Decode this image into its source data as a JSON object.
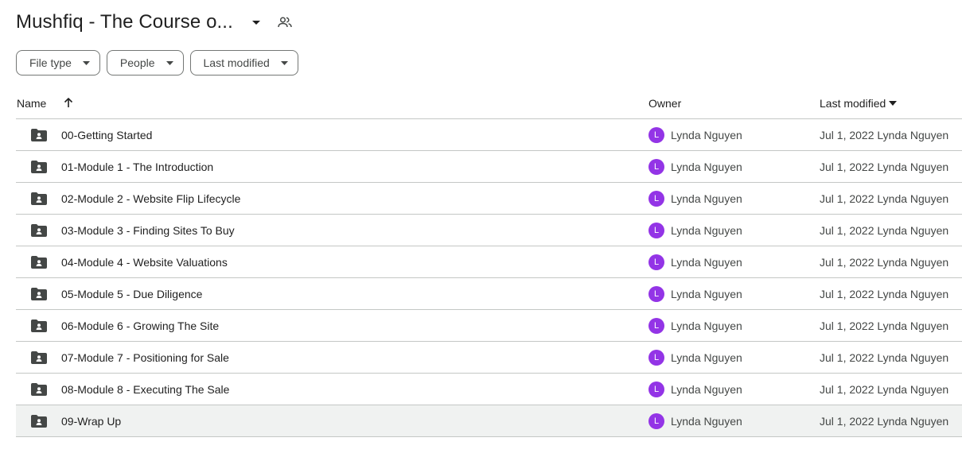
{
  "header": {
    "title": "Mushfiq - The Course o...",
    "title_caret_icon": "arrow-drop-down-icon",
    "shared_icon": "people-icon"
  },
  "filters": [
    {
      "label": "File type"
    },
    {
      "label": "People"
    },
    {
      "label": "Last modified"
    }
  ],
  "columns": {
    "name": "Name",
    "owner": "Owner",
    "last_modified": "Last modified"
  },
  "sort": {
    "column": "Name",
    "direction": "ascending"
  },
  "rows": [
    {
      "name": "00-Getting Started",
      "owner": "Lynda Nguyen",
      "avatar": "L",
      "modified": "Jul 1, 2022 Lynda Nguyen"
    },
    {
      "name": "01-Module 1 - The Introduction",
      "owner": "Lynda Nguyen",
      "avatar": "L",
      "modified": "Jul 1, 2022 Lynda Nguyen"
    },
    {
      "name": "02-Module 2 - Website Flip Lifecycle",
      "owner": "Lynda Nguyen",
      "avatar": "L",
      "modified": "Jul 1, 2022 Lynda Nguyen"
    },
    {
      "name": "03-Module 3 - Finding Sites To Buy",
      "owner": "Lynda Nguyen",
      "avatar": "L",
      "modified": "Jul 1, 2022 Lynda Nguyen"
    },
    {
      "name": "04-Module 4 - Website Valuations",
      "owner": "Lynda Nguyen",
      "avatar": "L",
      "modified": "Jul 1, 2022 Lynda Nguyen"
    },
    {
      "name": "05-Module 5 - Due Diligence",
      "owner": "Lynda Nguyen",
      "avatar": "L",
      "modified": "Jul 1, 2022 Lynda Nguyen"
    },
    {
      "name": "06-Module 6 - Growing The Site",
      "owner": "Lynda Nguyen",
      "avatar": "L",
      "modified": "Jul 1, 2022 Lynda Nguyen"
    },
    {
      "name": "07-Module 7 - Positioning for Sale",
      "owner": "Lynda Nguyen",
      "avatar": "L",
      "modified": "Jul 1, 2022 Lynda Nguyen"
    },
    {
      "name": "08-Module 8 - Executing The Sale",
      "owner": "Lynda Nguyen",
      "avatar": "L",
      "modified": "Jul 1, 2022 Lynda Nguyen"
    },
    {
      "name": "09-Wrap Up",
      "owner": "Lynda Nguyen",
      "avatar": "L",
      "modified": "Jul 1, 2022 Lynda Nguyen",
      "selected": true
    }
  ],
  "colors": {
    "avatar": "#9334e6",
    "icon": "#444746",
    "divider": "#c4c7c5",
    "hover_row": "#f0f2f1"
  }
}
